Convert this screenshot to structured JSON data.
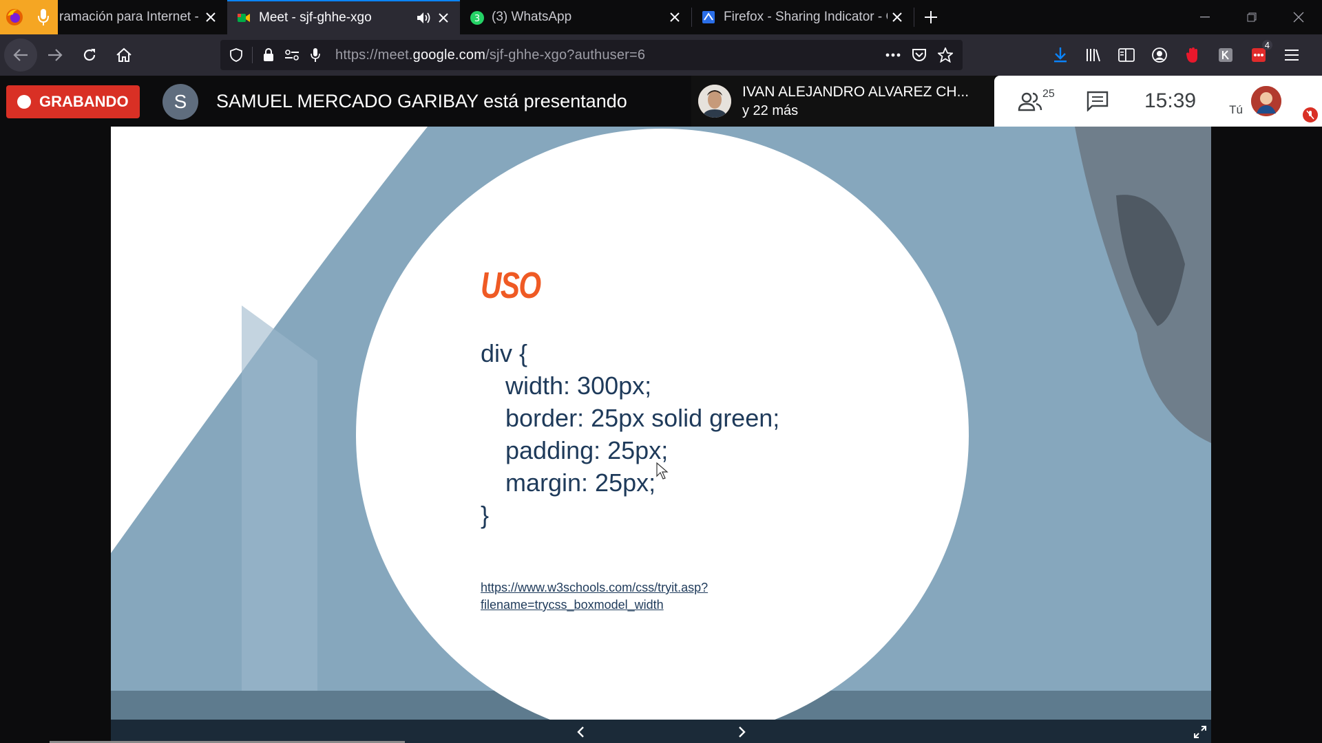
{
  "browser": {
    "tabs": [
      {
        "title": "ramación para Internet - 2",
        "selected": false
      },
      {
        "title": "Meet - sjf-ghhe-xgo",
        "selected": true
      },
      {
        "title": "(3) WhatsApp",
        "selected": false
      },
      {
        "title": "Firefox - Sharing Indicator - Gy",
        "selected": false
      }
    ],
    "whatsapp_badge": "3",
    "url_prefix": "https://meet.",
    "url_domain": "google.com",
    "url_suffix": "/sjf-ghhe-xgo?authuser=6",
    "extension_badge": "4",
    "accent_color": "#0a84ff"
  },
  "meet": {
    "recording_label": "GRABANDO",
    "presenter_initial": "S",
    "presenting_text": "SAMUEL MERCADO GARIBAY está presentando",
    "participant_name": "IVAN ALEJANDRO ALVAREZ CH...",
    "participant_more": "y 22 más",
    "participant_count": "25",
    "clock": "15:39",
    "self_label": "Tú",
    "recording_color": "#d93025"
  },
  "slide": {
    "title": "USO",
    "code_open": "div {",
    "code_lines": [
      "width: 300px;",
      "border: 25px solid green;",
      "padding: 25px;",
      "margin: 25px;"
    ],
    "code_close": "}",
    "link_line1": "https://www.w3schools.com/css/tryit.asp?",
    "link_line2": "filename=trycss_boxmodel_width",
    "title_color": "#ef5a24",
    "text_color": "#1e3a5a"
  }
}
